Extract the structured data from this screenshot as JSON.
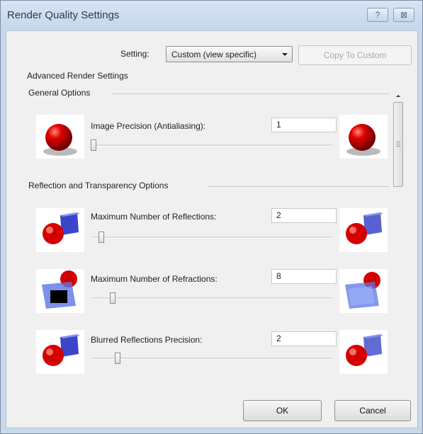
{
  "window": {
    "title": "Render Quality Settings",
    "help_glyph": "?",
    "close_glyph": "⊠"
  },
  "setting": {
    "label": "Setting:",
    "value": "Custom (view specific)",
    "copy_button": "Copy To Custom"
  },
  "advanced_heading": "Advanced Render Settings",
  "groups": {
    "general": "General Options",
    "reflection": "Reflection and Transparency Options"
  },
  "options": [
    {
      "label": "Image Precision (Antialiasing):",
      "value": "1",
      "slider_level": 0.0,
      "icon": "red-sphere-icon"
    },
    {
      "label": "Maximum Number of Reflections:",
      "value": "2",
      "slider_level": 0.04,
      "icon": "sphere-and-cube-icon"
    },
    {
      "label": "Maximum Number of Refractions:",
      "value": "8",
      "slider_level": 0.09,
      "icon": "refraction-cube-icon"
    },
    {
      "label": "Blurred Reflections Precision:",
      "value": "2",
      "slider_level": 0.1,
      "icon": "blurred-sphere-cube-icon"
    }
  ],
  "buttons": {
    "ok": "OK",
    "cancel": "Cancel"
  },
  "colors": {
    "sphere_red": "#d40000",
    "cube_blue": "#3b45c9",
    "title_bar": "#c5d7ec"
  }
}
